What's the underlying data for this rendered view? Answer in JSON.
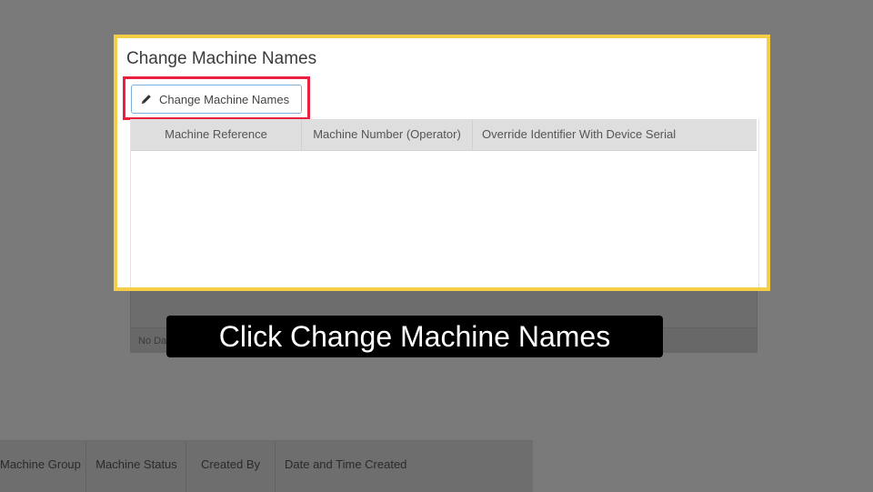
{
  "dialog": {
    "title": "Change Machine Names",
    "button_label": "Change Machine Names",
    "columns": [
      "Machine Reference",
      "Machine Number (Operator)",
      "Override Identifier With Device Serial"
    ],
    "no_data_text": "No Da"
  },
  "background_grid": {
    "columns": [
      "Machine Group",
      "Machine Status",
      "Created By",
      "Date and Time Created"
    ]
  },
  "caption": "Click Change Machine Names",
  "colors": {
    "highlight_border": "#f5cd47",
    "target_border": "#e8213f",
    "overlay": "#7a7a7a"
  },
  "icons": {
    "button_icon": "pencil-icon"
  }
}
